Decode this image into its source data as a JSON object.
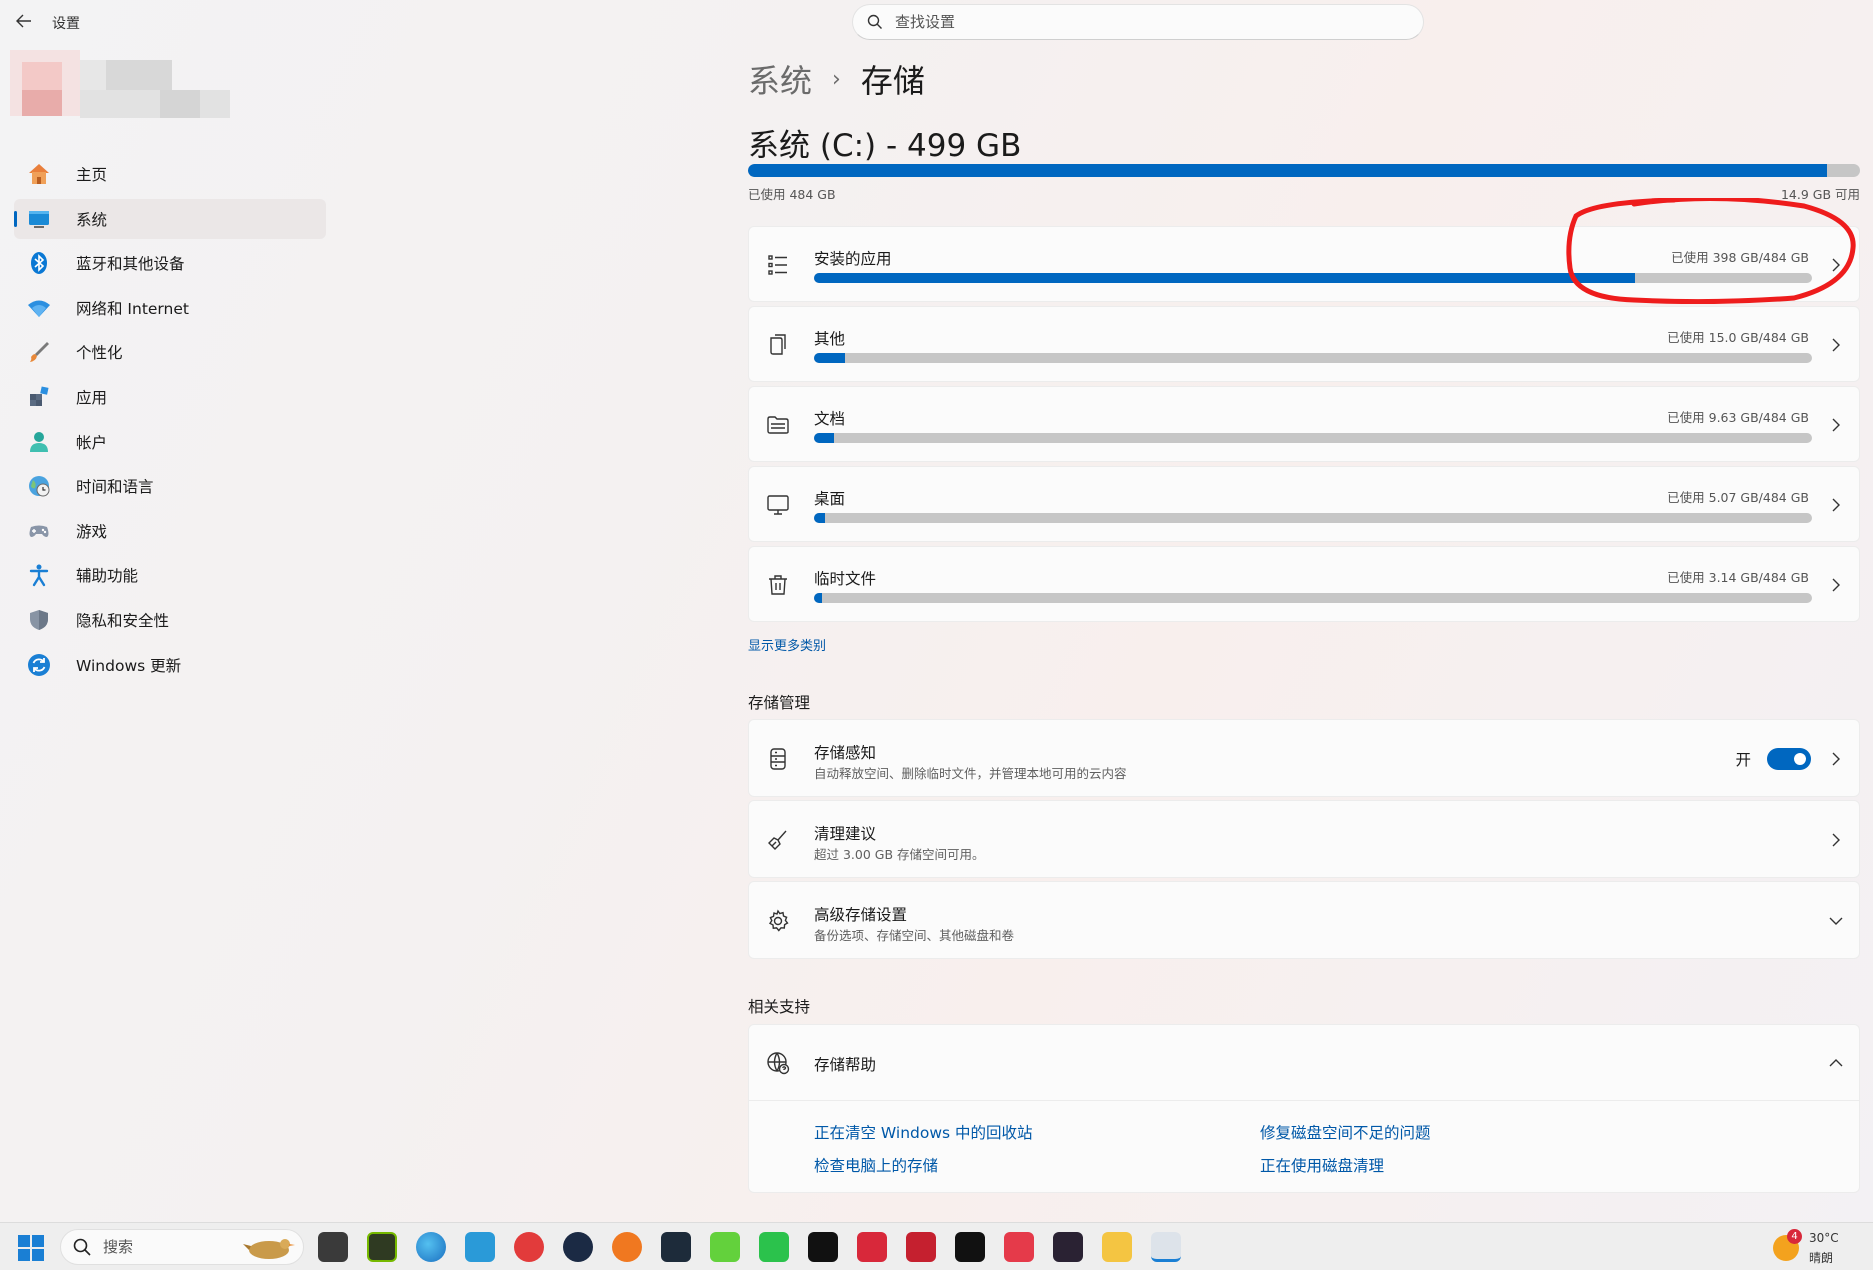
{
  "window": {
    "title": "设置"
  },
  "search": {
    "placeholder": "查找设置"
  },
  "sidebar": {
    "items": [
      {
        "label": "主页",
        "icon": "home-icon"
      },
      {
        "label": "系统",
        "icon": "system-icon",
        "active": true
      },
      {
        "label": "蓝牙和其他设备",
        "icon": "bluetooth-icon"
      },
      {
        "label": "网络和 Internet",
        "icon": "wifi-icon"
      },
      {
        "label": "个性化",
        "icon": "brush-icon"
      },
      {
        "label": "应用",
        "icon": "apps-icon"
      },
      {
        "label": "帐户",
        "icon": "account-icon"
      },
      {
        "label": "时间和语言",
        "icon": "globe-clock-icon"
      },
      {
        "label": "游戏",
        "icon": "gamepad-icon"
      },
      {
        "label": "辅助功能",
        "icon": "accessibility-icon"
      },
      {
        "label": "隐私和安全性",
        "icon": "shield-icon"
      },
      {
        "label": "Windows 更新",
        "icon": "update-icon"
      }
    ]
  },
  "breadcrumb": {
    "parent": "系统",
    "current": "存储"
  },
  "drive": {
    "title": "系统 (C:) - 499 GB",
    "used_label": "已使用 484 GB",
    "free_label": "14.9 GB 可用",
    "used_fraction": 0.97
  },
  "categories": [
    {
      "label": "安装的应用",
      "usage": "已使用 398 GB/484 GB",
      "fraction": 0.823,
      "icon": "list-icon"
    },
    {
      "label": "其他",
      "usage": "已使用 15.0 GB/484 GB",
      "fraction": 0.031,
      "icon": "document-copy-icon"
    },
    {
      "label": "文档",
      "usage": "已使用 9.63 GB/484 GB",
      "fraction": 0.02,
      "icon": "folder-icon"
    },
    {
      "label": "桌面",
      "usage": "已使用 5.07 GB/484 GB",
      "fraction": 0.011,
      "icon": "monitor-icon"
    },
    {
      "label": "临时文件",
      "usage": "已使用 3.14 GB/484 GB",
      "fraction": 0.007,
      "icon": "trash-icon"
    }
  ],
  "show_more": "显示更多类别",
  "management": {
    "title": "存储管理",
    "items": [
      {
        "label": "存储感知",
        "sub": "自动释放空间、删除临时文件，并管理本地可用的云内容",
        "toggle_label": "开",
        "toggle_on": true
      },
      {
        "label": "清理建议",
        "sub": "超过 3.00 GB 存储空间可用。"
      },
      {
        "label": "高级存储设置",
        "sub": "备份选项、存储空间、其他磁盘和卷"
      }
    ]
  },
  "support": {
    "title": "相关支持",
    "help_title": "存储帮助",
    "links": [
      "正在清空 Windows 中的回收站",
      "修复磁盘空间不足的问题",
      "检查电脑上的存储",
      "正在使用磁盘清理"
    ]
  },
  "taskbar": {
    "search_placeholder": "搜索",
    "weather_temp": "30°C",
    "weather_cond": "晴朗",
    "badge_count": "4"
  },
  "colors": {
    "accent": "#0067c0",
    "annotation": "#ee1c1c"
  }
}
